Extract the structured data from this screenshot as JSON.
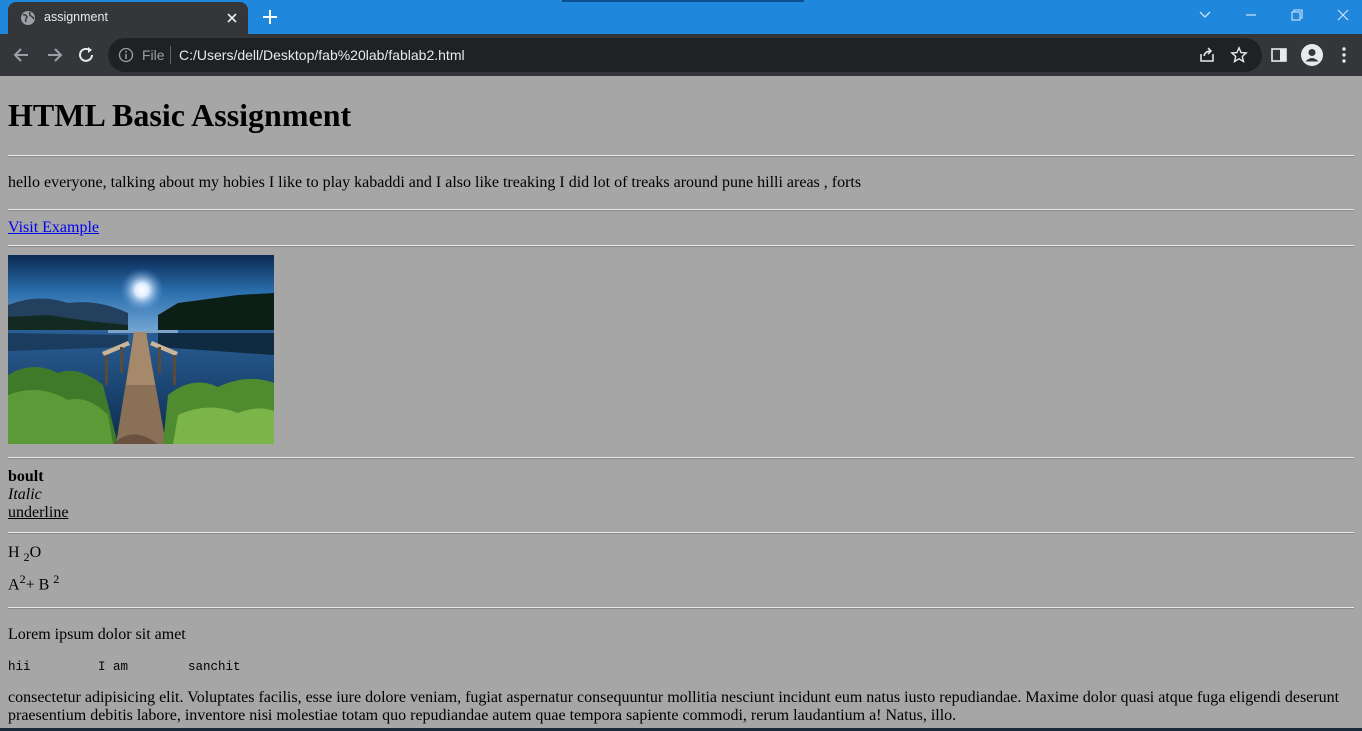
{
  "browser": {
    "tab_title": "assignment",
    "address_prefix": "File",
    "url": "C:/Users/dell/Desktop/fab%20lab/fablab2.html"
  },
  "page": {
    "heading": "HTML Basic Assignment",
    "hobbies_text": "hello everyone, talking about my hobies I like to play kabaddi and I also like treaking I did lot of treaks around pune hilli areas , forts",
    "link_text": "Visit Example",
    "bold_text": "boult",
    "italic_text": "Italic",
    "underline_text": "underline",
    "chem": {
      "h": "H",
      "sub": "2",
      "o": "O",
      "a": "A",
      "sup1": "2",
      "plus_b": "+ B",
      "sup2": "2"
    },
    "lorem_short": "Lorem ipsum dolor sit amet",
    "pre_text": "hii         I am        sanchit",
    "lorem_long": "consectetur adipisicing elit. Voluptates facilis, esse iure dolore veniam, fugiat aspernatur consequuntur mollitia nesciunt incidunt eum natus iusto repudiandae. Maxime dolor quasi atque fuga eligendi deserunt praesentium debitis labore, inventore nisi molestiae totam quo repudiandae autem quae tempora sapiente commodi, rerum laudantium a! Natus, illo."
  },
  "icons": {
    "tab": [
      "globe-icon",
      "close-icon"
    ],
    "toolbar": [
      "back-icon",
      "forward-icon",
      "reload-icon",
      "info-icon",
      "share-icon",
      "star-icon",
      "side-panel-icon",
      "profile-icon",
      "menu-icon"
    ],
    "window": [
      "tab-search-icon",
      "minimize-icon",
      "restore-icon",
      "window-close-icon"
    ]
  },
  "colors": {
    "titlebar": "#1f87dc",
    "toolbar": "#35363a",
    "page_background": "#a6a6a6",
    "link": "#0000ee"
  }
}
